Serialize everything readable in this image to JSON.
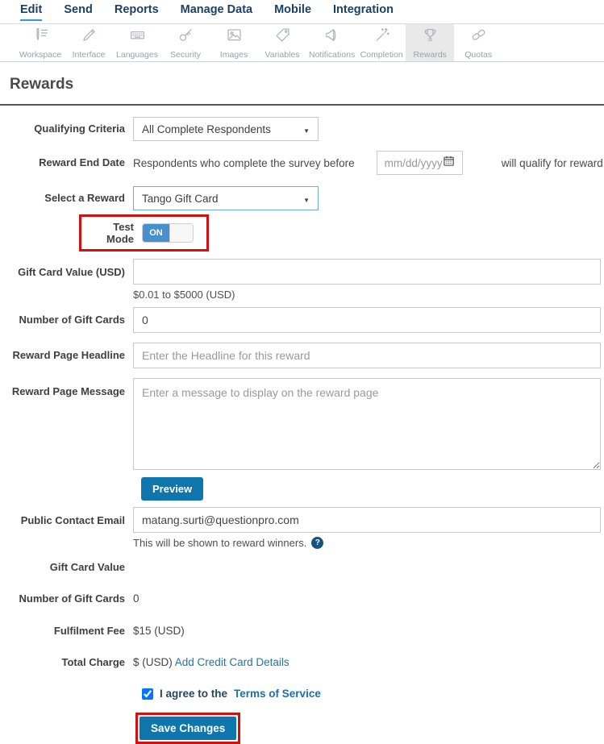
{
  "nav": {
    "items": [
      {
        "label": "Edit",
        "active": true
      },
      {
        "label": "Send",
        "active": false
      },
      {
        "label": "Reports",
        "active": false
      },
      {
        "label": "Manage Data",
        "active": false
      },
      {
        "label": "Mobile",
        "active": false
      },
      {
        "label": "Integration",
        "active": false
      }
    ]
  },
  "toolbar": {
    "items": [
      {
        "label": "Workspace",
        "icon": "pen-list-icon",
        "active": false
      },
      {
        "label": "Interface",
        "icon": "pen-icon",
        "active": false
      },
      {
        "label": "Languages",
        "icon": "keyboard-icon",
        "active": false
      },
      {
        "label": "Security",
        "icon": "key-icon",
        "active": false
      },
      {
        "label": "Images",
        "icon": "image-icon",
        "active": false
      },
      {
        "label": "Variables",
        "icon": "tag-icon",
        "active": false
      },
      {
        "label": "Notifications",
        "icon": "megaphone-icon",
        "active": false
      },
      {
        "label": "Completion",
        "icon": "magic-wand-icon",
        "active": false
      },
      {
        "label": "Rewards",
        "icon": "trophy-icon",
        "active": true
      },
      {
        "label": "Quotas",
        "icon": "chain-link-icon",
        "active": false
      }
    ]
  },
  "page": {
    "title": "Rewards"
  },
  "form": {
    "qualifying_criteria": {
      "label": "Qualifying Criteria",
      "value": "All Complete Respondents"
    },
    "reward_end_date": {
      "label": "Reward End Date",
      "before_text": "Respondents who complete the survey before",
      "placeholder": "mm/dd/yyyy",
      "after_text": "will qualify for reward"
    },
    "select_reward": {
      "label": "Select a Reward",
      "value": "Tango Gift Card"
    },
    "test_mode": {
      "label": "Test Mode",
      "state": "ON"
    },
    "gift_card_value": {
      "label": "Gift Card Value (USD)",
      "value": "",
      "helper": "$0.01 to $5000 (USD)"
    },
    "number_of_gift_cards": {
      "label": "Number of Gift Cards",
      "value": "0"
    },
    "reward_page_headline": {
      "label": "Reward Page Headline",
      "placeholder": "Enter the Headline for this reward"
    },
    "reward_page_message": {
      "label": "Reward Page Message",
      "placeholder": "Enter a message to display on the reward page"
    },
    "preview_button": "Preview",
    "public_contact_email": {
      "label": "Public Contact Email",
      "value": "matang.surti@questionpro.com",
      "helper": "This will be shown to reward winners.",
      "help_icon": "?"
    },
    "summary": [
      {
        "label": "Gift Card Value",
        "value": ""
      },
      {
        "label": "Number of Gift Cards",
        "value": "0"
      },
      {
        "label": "Fulfilment Fee",
        "value": "$15 (USD)"
      },
      {
        "label": "Total Charge",
        "value": "$ (USD)",
        "link": "Add Credit Card Details"
      }
    ],
    "agree": {
      "checked": true,
      "text": "I agree to the",
      "link": "Terms of Service"
    },
    "save_button": "Save Changes"
  },
  "colors": {
    "nav_navy": "#1c4166",
    "nav_underline_blue": "#2e9bd6",
    "button_blue": "#0f76ad",
    "toggle_blue": "#4690cd",
    "link_blue": "#2274a8",
    "highlight_red": "#d40f0f",
    "active_tab_gray": "#e9e9e9"
  }
}
